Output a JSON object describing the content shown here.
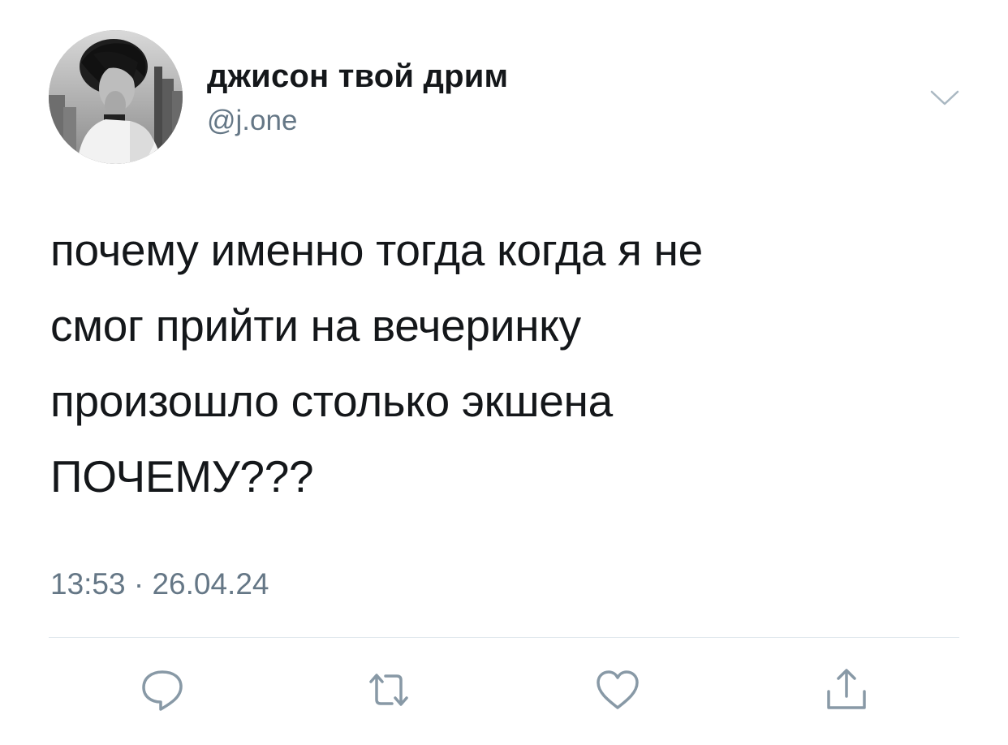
{
  "author": {
    "display_name": "джисон твой дрим",
    "handle": "@j.one"
  },
  "tweet": {
    "lines": [
      "почему именно тогда когда я не",
      "смог прийти на вечеринку",
      "произошло столько экшена",
      "ПОЧЕМУ???"
    ],
    "timestamp": "13:53 · 26.04.24"
  },
  "icons": {
    "more": "chevron-down-icon",
    "reply": "reply-icon",
    "retweet": "retweet-icon",
    "like": "heart-icon",
    "share": "share-icon"
  },
  "colors": {
    "text": "#14171a",
    "secondary": "#657786",
    "icon": "#8899a6",
    "divider": "#e1e8ed"
  }
}
